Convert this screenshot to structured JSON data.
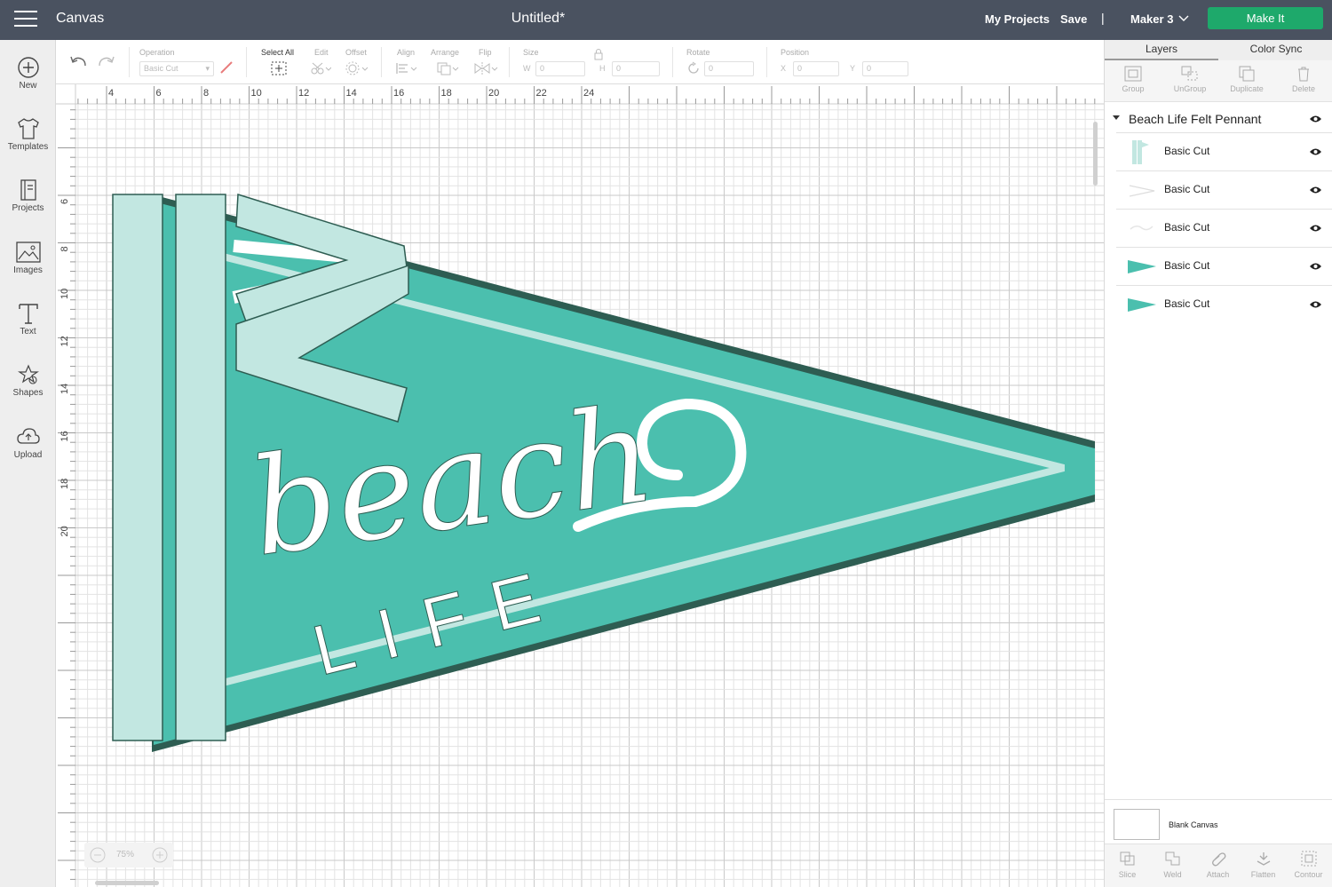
{
  "topbar": {
    "app_title": "Canvas",
    "doc_title": "Untitled*",
    "my_projects": "My Projects",
    "save": "Save",
    "separator": "|",
    "machine": "Maker 3",
    "make_it": "Make It"
  },
  "sidebar": {
    "items": [
      {
        "label": "New",
        "icon": "plus-circle-icon"
      },
      {
        "label": "Templates",
        "icon": "tshirt-icon"
      },
      {
        "label": "Projects",
        "icon": "notebook-icon"
      },
      {
        "label": "Images",
        "icon": "image-icon"
      },
      {
        "label": "Text",
        "icon": "text-t-icon"
      },
      {
        "label": "Shapes",
        "icon": "shapes-icon"
      },
      {
        "label": "Upload",
        "icon": "cloud-upload-icon"
      }
    ]
  },
  "toolbar": {
    "operation_label": "Operation",
    "operation_value": "Basic Cut",
    "select_all": "Select All",
    "edit": "Edit",
    "offset": "Offset",
    "align": "Align",
    "arrange": "Arrange",
    "flip": "Flip",
    "size": "Size",
    "w_label": "W",
    "w_value": "0",
    "h_label": "H",
    "h_value": "0",
    "rotate": "Rotate",
    "rotate_value": "0",
    "position": "Position",
    "x_label": "X",
    "x_value": "0",
    "y_label": "Y",
    "y_value": "0"
  },
  "canvas": {
    "ruler_top": [
      "4",
      "6",
      "8",
      "10",
      "12",
      "14",
      "16",
      "18",
      "20",
      "22",
      "24"
    ],
    "ruler_left": [
      "6",
      "8",
      "10",
      "12",
      "14",
      "16",
      "18",
      "20"
    ],
    "zoom": "75%",
    "design_text": {
      "script": "beach",
      "block": "LIFE"
    },
    "colors": {
      "teal": "#4bbfae",
      "mint": "#c2e7e1",
      "dark_outline": "#2e5d52",
      "grid_minor": "#e3e3e3",
      "grid_major": "#c9c9c9"
    }
  },
  "panel": {
    "tabs": [
      "Layers",
      "Color Sync"
    ],
    "actions": [
      "Group",
      "UnGroup",
      "Duplicate",
      "Delete"
    ],
    "group_name": "Beach Life Felt Pennant",
    "layers": [
      {
        "name": "Basic Cut",
        "thumb": "mint-pole"
      },
      {
        "name": "Basic Cut",
        "thumb": "white-outline"
      },
      {
        "name": "Basic Cut",
        "thumb": "white-text"
      },
      {
        "name": "Basic Cut",
        "thumb": "teal-pennant"
      },
      {
        "name": "Basic Cut",
        "thumb": "teal-pennant"
      }
    ],
    "blank_canvas": "Blank Canvas",
    "bottom_tools": [
      "Slice",
      "Weld",
      "Attach",
      "Flatten",
      "Contour"
    ]
  }
}
